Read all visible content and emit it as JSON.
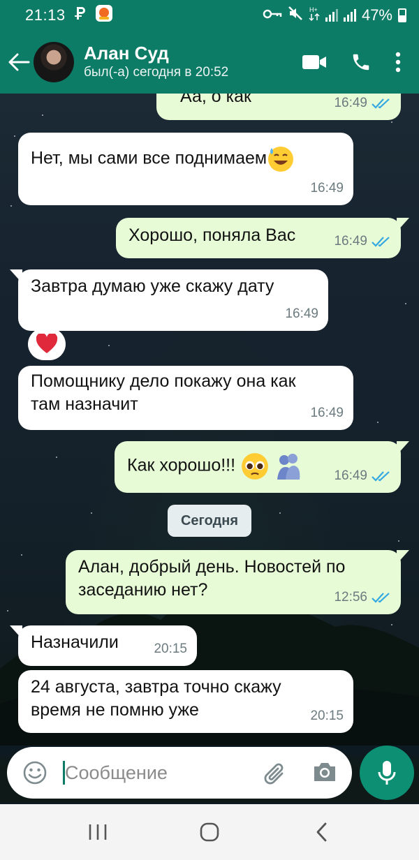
{
  "status_bar": {
    "time": "21:13",
    "battery": "47%",
    "icons": [
      "p-app-icon",
      "orange-app-icon",
      "key-icon",
      "mute-icon",
      "data-icon",
      "signal-icon",
      "signal-icon",
      "battery-icon"
    ]
  },
  "header": {
    "contact_name": "Алан Суд",
    "last_seen": "был(-а) сегодня в 20:52",
    "actions": [
      "video-call-icon",
      "phone-icon",
      "more-icon"
    ]
  },
  "messages": [
    {
      "direction": "out",
      "text": "Аа, о как",
      "time": "16:49",
      "read": true
    },
    {
      "direction": "in",
      "text": "Нет, мы сами все поднимаем",
      "emoji": "sweat-smile-emoji",
      "time": "16:49"
    },
    {
      "direction": "out",
      "text": "Хорошо, поняла Вас",
      "time": "16:49",
      "read": true
    },
    {
      "direction": "in",
      "text": "Завтра думаю уже скажу дату",
      "time": "16:49",
      "reaction": "heart-emoji"
    },
    {
      "direction": "in",
      "text": "Помощнику дело покажу она как там назначит",
      "time": "16:49"
    },
    {
      "direction": "out",
      "text": "Как хорошо!!!",
      "emojis": [
        "pleading-face-emoji",
        "hugging-people-emoji"
      ],
      "time": "16:49",
      "read": true
    },
    {
      "direction": "out",
      "text": "Алан, добрый день. Новостей по заседанию нет?",
      "time": "12:56",
      "read": true
    },
    {
      "direction": "in",
      "text": "Назначили",
      "time": "20:15"
    },
    {
      "direction": "in",
      "text": "24 августа, завтра точно скажу время не помню уже",
      "time": "20:15"
    }
  ],
  "date_divider": "Сегодня",
  "composer": {
    "placeholder": "Сообщение",
    "value": ""
  },
  "colors": {
    "header": "#0d7c66",
    "outgoing_bubble": "#e6fbd6",
    "incoming_bubble": "#ffffff",
    "read_tick": "#34a8e0",
    "mic_button": "#0d8f73"
  }
}
